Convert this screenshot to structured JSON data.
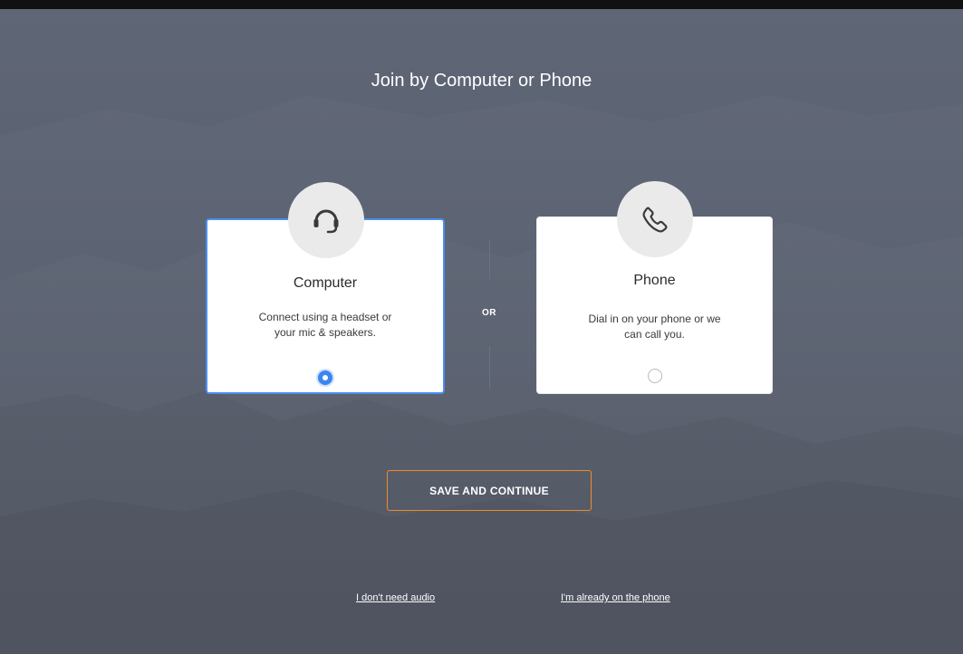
{
  "dialog": {
    "title": "Join by Computer or Phone",
    "separator": "OR",
    "save_button": "SAVE AND CONTINUE"
  },
  "options": {
    "computer": {
      "title": "Computer",
      "description_line1": "Connect using a headset or",
      "description_line2": "your mic & speakers.",
      "icon": "headset-icon",
      "selected": true
    },
    "phone": {
      "title": "Phone",
      "description_line1": "Dial in on your phone or we",
      "description_line2": "can call you.",
      "icon": "phone-icon",
      "selected": false
    }
  },
  "links": {
    "no_audio": "I don't need audio",
    "already_on_phone": "I'm already on the phone"
  },
  "colors": {
    "background": "#5a6171",
    "accent_blue": "#3a86f0",
    "button_border": "#ee8c2d",
    "card": "#ffffff"
  }
}
